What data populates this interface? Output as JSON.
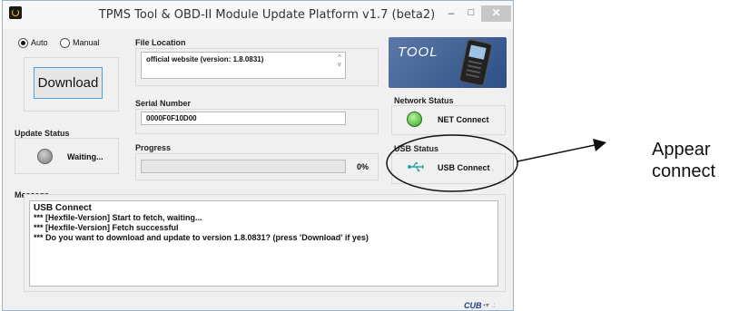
{
  "window": {
    "title": "TPMS Tool & OBD-II Module Update Platform v1.7 (beta2)",
    "controls": {
      "minimize": "–",
      "maximize": "□",
      "close": "✕"
    }
  },
  "mode": {
    "auto_label": "Auto",
    "manual_label": "Manual",
    "selected": "Auto"
  },
  "download_button": "Download",
  "file_location": {
    "label": "File Location",
    "value": "official website (version: 1.8.0831)"
  },
  "serial": {
    "label": "Serial Number",
    "value": "0000F0F10D00"
  },
  "update_status": {
    "label": "Update Status",
    "text": "Waiting...",
    "led": "grey"
  },
  "progress": {
    "label": "Progress",
    "percent_text": "0%",
    "value": 0
  },
  "logo": {
    "text": "TOOL",
    "icon": "scan-tool-device-icon"
  },
  "network_status": {
    "label": "Network Status",
    "text": "NET Connect",
    "led": "green"
  },
  "usb_status": {
    "label": "USB Status",
    "text": "USB Connect",
    "icon": "usb-icon"
  },
  "message": {
    "label": "Message",
    "lines": [
      "USB Connect",
      "*** [Hexfile-Version] Start to fetch, waiting...",
      "*** [Hexfile-Version] Fetch successful",
      "*** Do you want to download and update to version 1.8.0831? (press 'Download' if yes)"
    ]
  },
  "statusbar": {
    "brand": "CUB"
  },
  "annotation": {
    "line1": "Appear",
    "line2": "connect"
  },
  "colors": {
    "accent_border": "#4fa0da",
    "led_green": "#2fa51f",
    "led_grey": "#7a7a7a",
    "annotation": "#111111"
  }
}
